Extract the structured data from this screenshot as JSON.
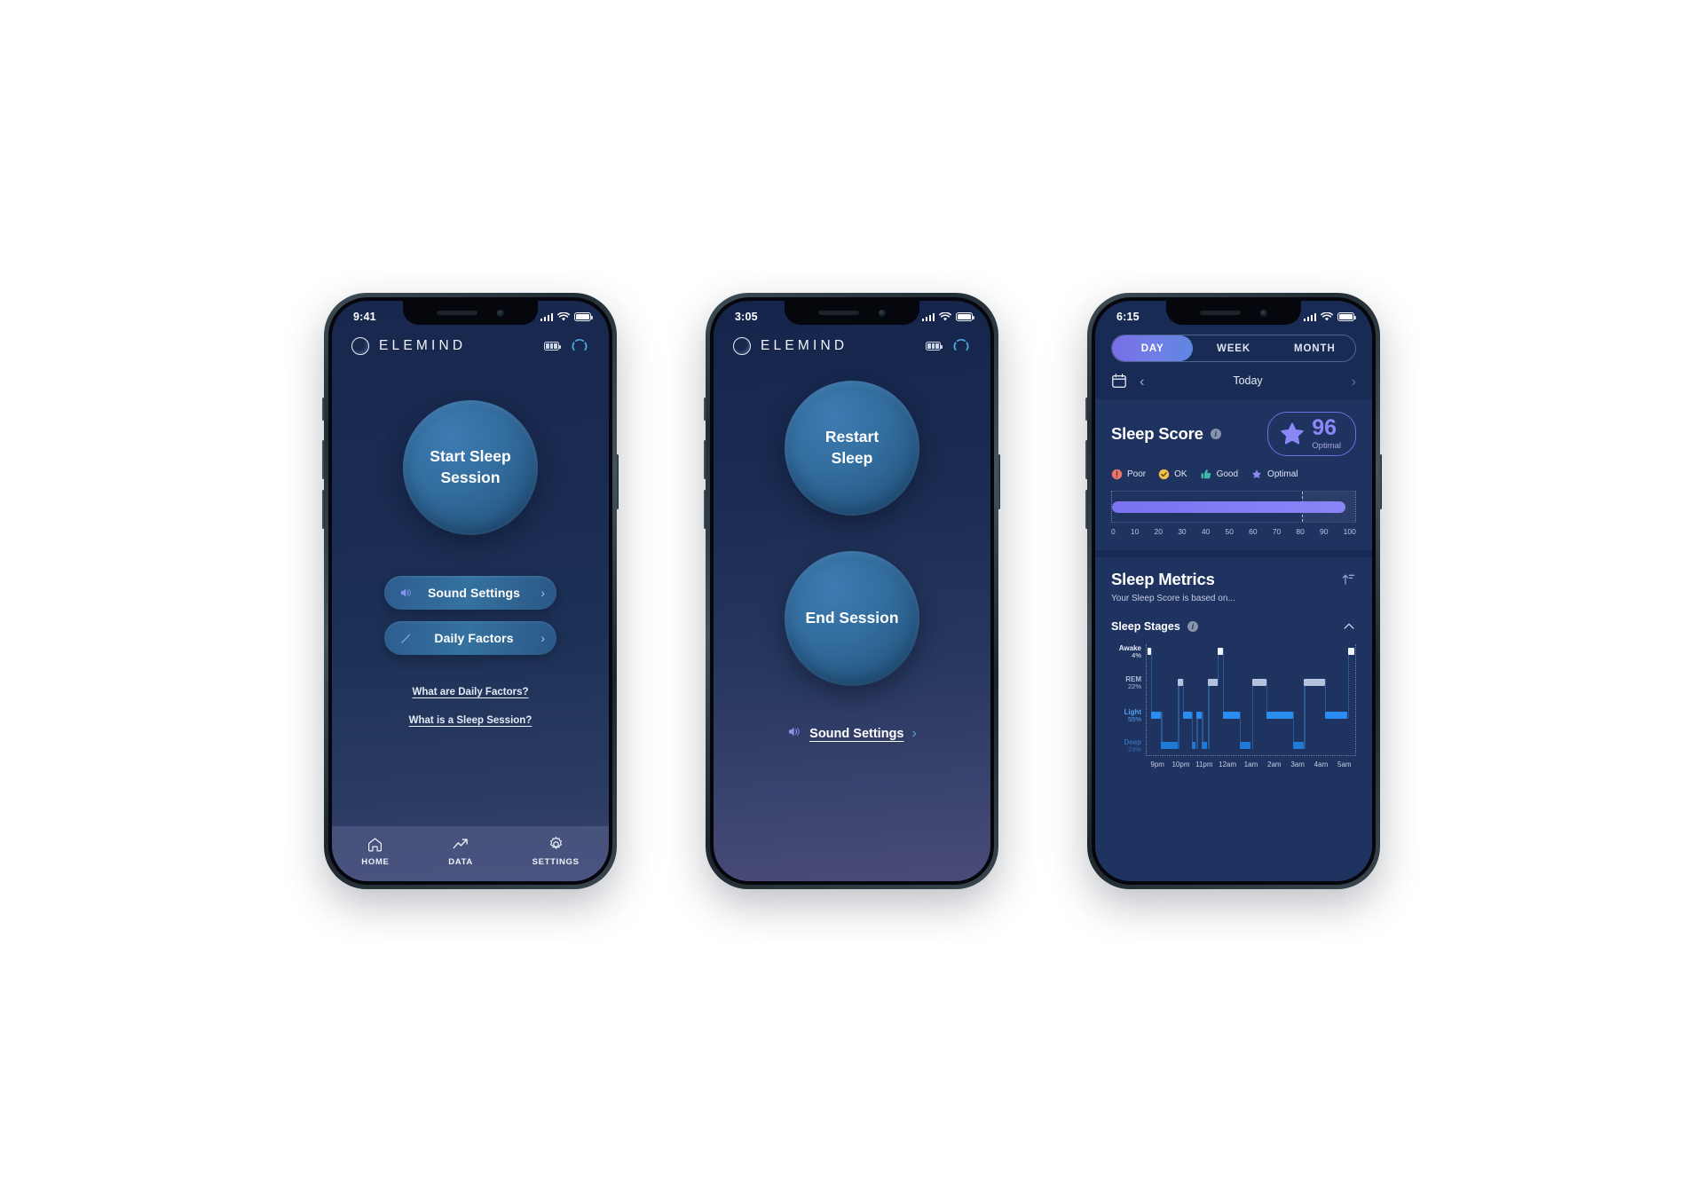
{
  "brand": {
    "name": "ELEMIND",
    "logo_icon": "circle-ring-icon"
  },
  "phone_home": {
    "status": {
      "time": "9:41",
      "signal_icon": "cellular-signal-icon",
      "wifi_icon": "wifi-icon",
      "battery_icon": "battery-icon"
    },
    "header_icons": {
      "battery": "device-battery-icon",
      "sync": "sync-arc-icon"
    },
    "primary_button": {
      "label_line1": "Start Sleep",
      "label_line2": "Session"
    },
    "pills": [
      {
        "label": "Sound Settings",
        "icon": "speaker-icon",
        "chevron": "›"
      },
      {
        "label": "Daily Factors",
        "icon": "pencil-icon",
        "chevron": "›"
      }
    ],
    "links": [
      "What are Daily Factors?",
      "What is a Sleep Session?"
    ],
    "tabs": [
      {
        "label": "HOME",
        "icon": "home-icon",
        "active": true
      },
      {
        "label": "DATA",
        "icon": "trend-up-icon",
        "active": false
      },
      {
        "label": "SETTINGS",
        "icon": "gear-icon",
        "active": false
      }
    ]
  },
  "phone_session": {
    "status": {
      "time": "3:05",
      "signal_icon": "cellular-signal-icon",
      "wifi_icon": "wifi-icon",
      "battery_icon": "battery-icon"
    },
    "restart_button": {
      "label_line1": "Restart",
      "label_line2": "Sleep"
    },
    "end_button": {
      "label": "End Session"
    },
    "sound_link": {
      "label": "Sound Settings",
      "icon": "speaker-icon",
      "chevron": "›"
    }
  },
  "phone_data": {
    "status": {
      "time": "6:15",
      "signal_icon": "cellular-signal-icon",
      "wifi_icon": "wifi-icon",
      "battery_icon": "battery-icon"
    },
    "range_tabs": [
      {
        "label": "DAY",
        "active": true
      },
      {
        "label": "WEEK",
        "active": false
      },
      {
        "label": "MONTH",
        "active": false
      }
    ],
    "date_nav": {
      "calendar_icon": "calendar-icon",
      "prev": "‹",
      "label": "Today",
      "next": "›"
    },
    "sleep_score": {
      "title": "Sleep Score",
      "info_icon": "info-icon",
      "value": "96",
      "qualifier": "Optimal",
      "badge_icon": "star-icon",
      "accent_color": "#8b87f5",
      "legend": [
        {
          "label": "Poor",
          "icon": "alert-circle-icon",
          "color": "#e8786f"
        },
        {
          "label": "OK",
          "icon": "check-circle-icon",
          "color": "#f2c14b"
        },
        {
          "label": "Good",
          "icon": "thumbs-up-icon",
          "color": "#3fb8aa"
        },
        {
          "label": "Optimal",
          "icon": "star-icon",
          "color": "#8b87f5"
        }
      ],
      "gauge_ticks": [
        "0",
        "10",
        "20",
        "30",
        "40",
        "50",
        "60",
        "70",
        "80",
        "90",
        "100"
      ]
    },
    "sleep_metrics": {
      "title": "Sleep Metrics",
      "subtitle": "Your Sleep Score is based on...",
      "sort_icon": "sort-ascending-icon",
      "stages_label": "Sleep Stages",
      "stages_info_icon": "info-icon",
      "collapse_icon": "chevron-up-icon"
    }
  },
  "chart_data": {
    "type": "area",
    "title": "Sleep Stages",
    "xlabel": "",
    "ylabel": "",
    "x_ticks": [
      "9pm",
      "10pm",
      "11pm",
      "12am",
      "1am",
      "2am",
      "3am",
      "4am",
      "5am"
    ],
    "stages": [
      {
        "name": "Awake",
        "percent": "4%",
        "percent_value": 4,
        "level": 0,
        "color": "#eef3fd"
      },
      {
        "name": "REM",
        "percent": "22%",
        "percent_value": 22,
        "level": 1,
        "color": "#b3c2dd"
      },
      {
        "name": "Light",
        "percent": "55%",
        "percent_value": 55,
        "level": 2,
        "color": "#2b8cf0"
      },
      {
        "name": "Deep",
        "percent": "23%",
        "percent_value": 23,
        "level": 3,
        "color": "#1e7ad6"
      }
    ],
    "segments": [
      {
        "stage": "Awake",
        "start": 0.5,
        "end": 2.0
      },
      {
        "stage": "Light",
        "start": 2.0,
        "end": 7.0
      },
      {
        "stage": "Deep",
        "start": 7.0,
        "end": 15.0
      },
      {
        "stage": "REM",
        "start": 15.0,
        "end": 17.5
      },
      {
        "stage": "Light",
        "start": 17.5,
        "end": 21.5
      },
      {
        "stage": "Deep",
        "start": 21.5,
        "end": 23.5
      },
      {
        "stage": "Light",
        "start": 24.0,
        "end": 26.5
      },
      {
        "stage": "Deep",
        "start": 26.5,
        "end": 29.0
      },
      {
        "stage": "REM",
        "start": 29.5,
        "end": 34.0
      },
      {
        "stage": "Awake",
        "start": 34.0,
        "end": 36.5
      },
      {
        "stage": "Light",
        "start": 36.5,
        "end": 44.5
      },
      {
        "stage": "Deep",
        "start": 44.5,
        "end": 50.0
      },
      {
        "stage": "REM",
        "start": 50.5,
        "end": 57.5
      },
      {
        "stage": "Light",
        "start": 57.5,
        "end": 70.0
      },
      {
        "stage": "Deep",
        "start": 70.0,
        "end": 75.5
      },
      {
        "stage": "REM",
        "start": 75.5,
        "end": 85.5
      },
      {
        "stage": "Light",
        "start": 85.5,
        "end": 96.0
      },
      {
        "stage": "Awake",
        "start": 96.5,
        "end": 99.5
      }
    ],
    "gauge": {
      "value": 96,
      "min": 0,
      "max": 100,
      "threshold": 78
    }
  }
}
